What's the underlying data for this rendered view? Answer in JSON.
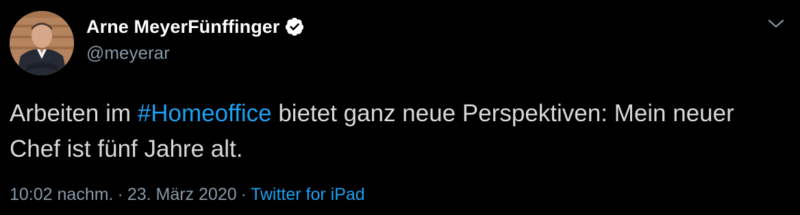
{
  "tweet": {
    "author": {
      "display_name": "Arne MeyerFünffinger",
      "handle": "@meyerar",
      "verified": true,
      "avatar_icon": "profile-photo"
    },
    "text_before": "Arbeiten im ",
    "hashtag": "#Homeoffice",
    "text_after": " bietet ganz neue Perspektiven: Mein neuer Chef ist fünf Jahre alt.",
    "time": "10:02 nachm.",
    "separator": "·",
    "date": "23. März 2020",
    "source": "Twitter for iPad",
    "menu_icon": "chevron-down-icon"
  },
  "colors": {
    "background": "#000000",
    "name": "#ffffff",
    "text": "#d9d9d9",
    "secondary": "#8899a6",
    "link": "#1da1f2"
  }
}
